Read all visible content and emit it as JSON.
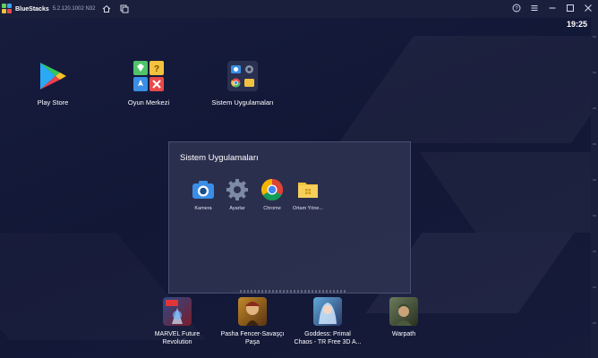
{
  "titlebar": {
    "app_name": "BlueStacks",
    "version": "5.2.120.1002 N32"
  },
  "status": {
    "time": "19:25"
  },
  "home_apps": [
    {
      "label": "Play Store"
    },
    {
      "label": "Oyun Merkezi"
    },
    {
      "label": "Sistem Uygulamaları"
    }
  ],
  "folder": {
    "title": "Sistem Uygulamaları",
    "apps": [
      {
        "label": "Kamera"
      },
      {
        "label": "Ayarlar"
      },
      {
        "label": "Chrome"
      },
      {
        "label": "Ortam Yöne..."
      }
    ]
  },
  "games": [
    {
      "label_line1": "MARVEL Future",
      "label_line2": "Revolution"
    },
    {
      "label_line1": "Pasha Fencer-Savaşçı",
      "label_line2": "Paşa"
    },
    {
      "label_line1": "Goddess: Primal",
      "label_line2": "Chaos - TR Free 3D A..."
    },
    {
      "label_line1": "Warpath",
      "label_line2": ""
    }
  ],
  "colors": {
    "background": "#121736",
    "titlebar": "#1a1f3c",
    "folder_panel": "#2e3250"
  }
}
